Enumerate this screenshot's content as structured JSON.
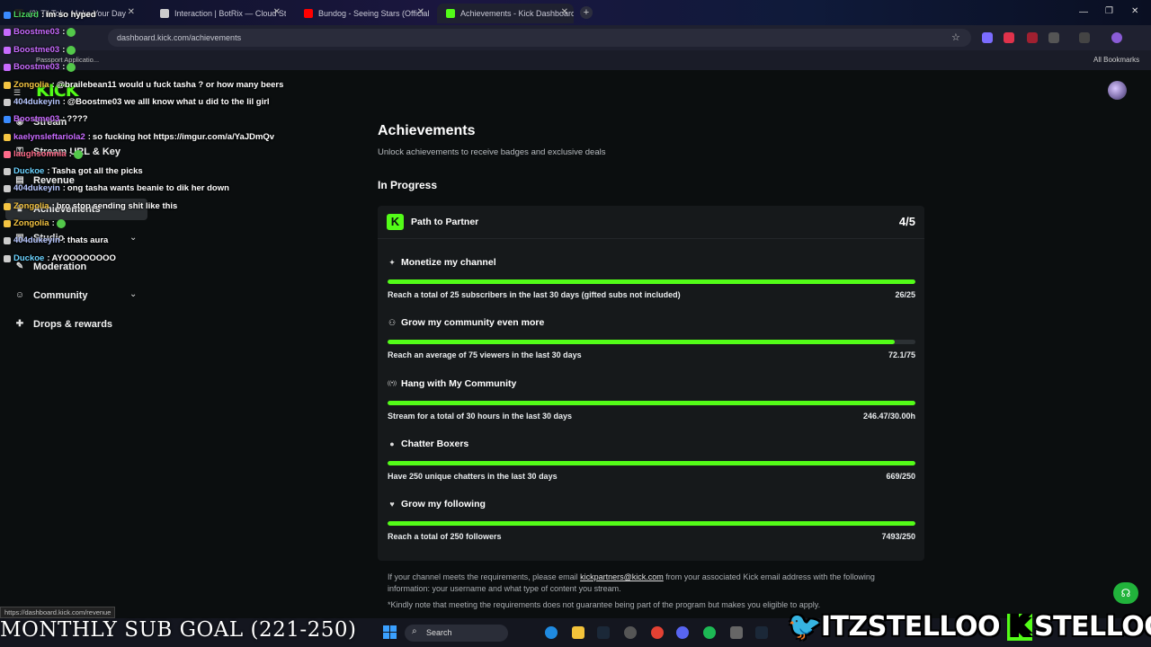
{
  "browser": {
    "tabs": [
      {
        "label": "(3) TikTok - Make Your Day",
        "active": false
      },
      {
        "label": "Interaction | BotRix — Cloud Stream",
        "active": false
      },
      {
        "label": "Bundog - Seeing Stars (Official",
        "active": false
      },
      {
        "label": "Achievements - Kick Dashboard",
        "active": true
      }
    ],
    "url": "dashboard.kick.com/achievements",
    "bookmark_item": "Passport Applicatio...",
    "all_bookmarks": "All Bookmarks"
  },
  "sidebar": {
    "logo": "KICK",
    "items": [
      {
        "label": "Stream",
        "icon": "stream-icon"
      },
      {
        "label": "Stream URL & Key",
        "icon": "key-icon"
      },
      {
        "label": "Revenue",
        "icon": "revenue-icon"
      },
      {
        "label": "Achievements",
        "icon": "trophy-icon"
      },
      {
        "label": "Studio",
        "icon": "studio-icon"
      },
      {
        "label": "Moderation",
        "icon": "wrench-icon"
      },
      {
        "label": "Community",
        "icon": "community-icon"
      },
      {
        "label": "Drops & rewards",
        "icon": "gift-icon"
      }
    ]
  },
  "main": {
    "title": "Achievements",
    "subtitle": "Unlock achievements to receive badges and exclusive deals",
    "section": "In Progress",
    "card": {
      "title": "Path to Partner",
      "count": "4/5",
      "achievements": [
        {
          "title": "Monetize my channel",
          "icon": "sparkle-icon",
          "requirement": "Reach a total of 25 subscribers in the last 30 days (gifted subs not included)",
          "progress": "26/25",
          "fill": 1.0
        },
        {
          "title": "Grow my community even more",
          "icon": "people-icon",
          "requirement": "Reach an average of 75 viewers in the last 30 days",
          "progress": "72.1/75",
          "fill": 0.961
        },
        {
          "title": "Hang with My Community",
          "icon": "broadcast-icon",
          "requirement": "Stream for a total of 30 hours in the last 30 days",
          "progress": "246.47/30.00h",
          "fill": 1.0
        },
        {
          "title": "Chatter Boxers",
          "icon": "chat-icon",
          "requirement": "Have 250 unique chatters in the last 30 days",
          "progress": "669/250",
          "fill": 1.0
        },
        {
          "title": "Grow my following",
          "icon": "heart-icon",
          "requirement": "Reach a total of 250 followers",
          "progress": "7493/250",
          "fill": 1.0
        }
      ]
    },
    "footer_pre": "If your channel meets the requirements, please email ",
    "footer_email": "kickpartners@kick.com",
    "footer_post": " from your associated Kick email address with the following information: your username and what type of content you stream.",
    "footer_note": "*Kindly note that meeting the requirements does not guarantee being part of the program but makes you eligible to apply."
  },
  "status_url": "https://dashboard.kick.com/revenue",
  "chat": [
    {
      "name": "Lizard",
      "color": "#4cd964",
      "msg": "im so hyped"
    },
    {
      "name": "Boostme03",
      "color": "#c86bff",
      "msg": ""
    },
    {
      "name": "Boostme03",
      "color": "#c86bff",
      "msg": ""
    },
    {
      "name": "Boostme03",
      "color": "#c86bff",
      "msg": ""
    },
    {
      "name": "Zongolia",
      "color": "#f5c542",
      "msg": "@brailebean11 would u fuck tasha ? or how many beers"
    },
    {
      "name": "404dukeyin",
      "color": "#b7c7ff",
      "msg": "@Boostme03 we alll know what u did to the lil girl"
    },
    {
      "name": "Boostme03",
      "color": "#c86bff",
      "msg": "????"
    },
    {
      "name": "kaelynsleftariola2",
      "color": "#c86bff",
      "msg": "so fucking hot https://imgur.com/a/YaJDmQv"
    },
    {
      "name": "laughsomnia",
      "color": "#ff6b8a",
      "msg": ""
    },
    {
      "name": "Duckoe",
      "color": "#6bd3ff",
      "msg": "Tasha got all the picks"
    },
    {
      "name": "404dukeyin",
      "color": "#b7c7ff",
      "msg": "ong tasha wants beanie to dik her down"
    },
    {
      "name": "Zongolia",
      "color": "#f5c542",
      "msg": "bro stop sending shit like this"
    },
    {
      "name": "Zongolia",
      "color": "#f5c542",
      "msg": ""
    },
    {
      "name": "404dukeyin",
      "color": "#b7c7ff",
      "msg": "thats aura"
    },
    {
      "name": "Duckoe",
      "color": "#6bd3ff",
      "msg": "AYOOOOOOOO"
    }
  ],
  "overlay": {
    "goal": "MONTHLY SUB GOAL (221-250)",
    "twitter": "ITZSTELLOO",
    "kick": "STELLOOO"
  },
  "taskbar": {
    "search": "Search"
  }
}
